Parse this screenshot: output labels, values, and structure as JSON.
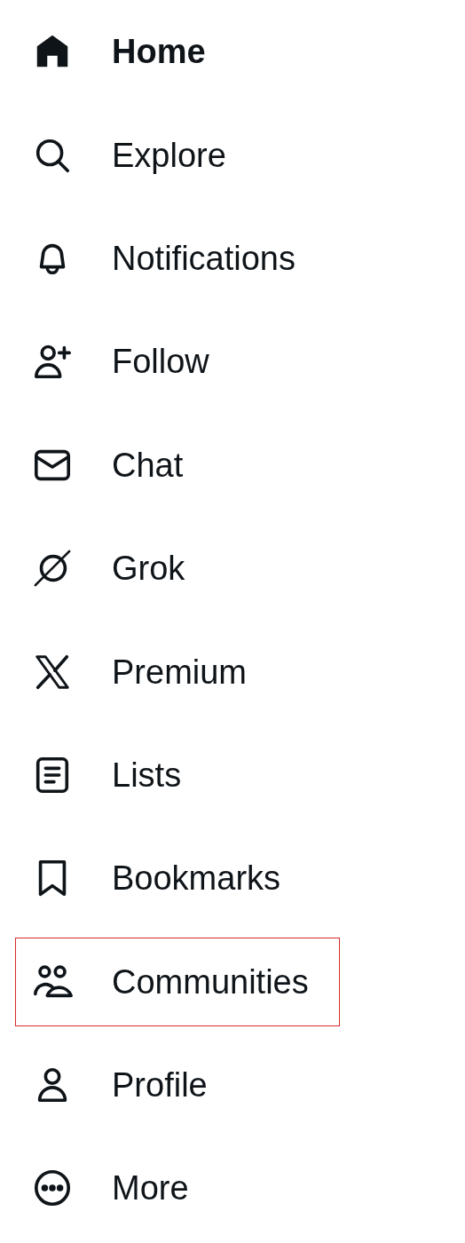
{
  "nav_items": [
    {
      "label": "Home",
      "kind": "home",
      "selected": true,
      "highlighted": false
    },
    {
      "label": "Explore",
      "kind": "search",
      "selected": false,
      "highlighted": false
    },
    {
      "label": "Notifications",
      "kind": "bell",
      "selected": false,
      "highlighted": false
    },
    {
      "label": "Follow",
      "kind": "follow",
      "selected": false,
      "highlighted": false
    },
    {
      "label": "Chat",
      "kind": "envelope",
      "selected": false,
      "highlighted": false
    },
    {
      "label": "Grok",
      "kind": "grok",
      "selected": false,
      "highlighted": false
    },
    {
      "label": "Premium",
      "kind": "premium",
      "selected": false,
      "highlighted": false
    },
    {
      "label": "Lists",
      "kind": "list",
      "selected": false,
      "highlighted": false
    },
    {
      "label": "Bookmarks",
      "kind": "bookmark",
      "selected": false,
      "highlighted": false
    },
    {
      "label": "Communities",
      "kind": "people",
      "selected": false,
      "highlighted": true
    },
    {
      "label": "Profile",
      "kind": "person",
      "selected": false,
      "highlighted": false
    },
    {
      "label": "More",
      "kind": "more",
      "selected": false,
      "highlighted": false
    }
  ]
}
